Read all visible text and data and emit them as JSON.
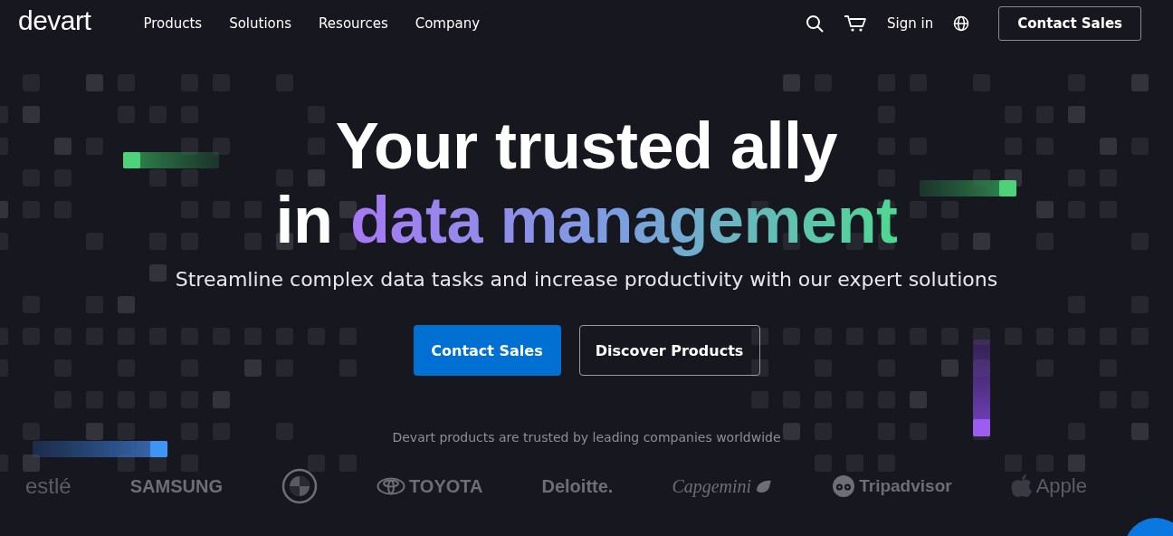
{
  "header": {
    "logo": "devart",
    "nav": [
      {
        "label": "Products"
      },
      {
        "label": "Solutions"
      },
      {
        "label": "Resources"
      },
      {
        "label": "Company"
      }
    ],
    "sign_in": "Sign in",
    "contact_button": "Contact Sales"
  },
  "hero": {
    "title_line1": "Your trusted ally",
    "title_line2_prefix": "in",
    "title_line2_highlight": "data management",
    "subtitle": "Streamline complex data tasks and increase productivity with our expert solutions",
    "primary_button": "Contact Sales",
    "secondary_button": "Discover Products"
  },
  "trusted": {
    "caption": "Devart products are trusted by leading companies worldwide",
    "logos": [
      {
        "kind": "text",
        "name": "estlé"
      },
      {
        "kind": "text",
        "name": "SAMSUNG"
      },
      {
        "kind": "emblem"
      },
      {
        "kind": "toyota",
        "name": "TOYOTA"
      },
      {
        "kind": "text",
        "name": "Deloitte."
      },
      {
        "kind": "capgemini",
        "name": "Capgemini"
      },
      {
        "kind": "tripadvisor",
        "name": "Tripadvisor"
      },
      {
        "kind": "apple",
        "name": "Apple"
      }
    ]
  }
}
